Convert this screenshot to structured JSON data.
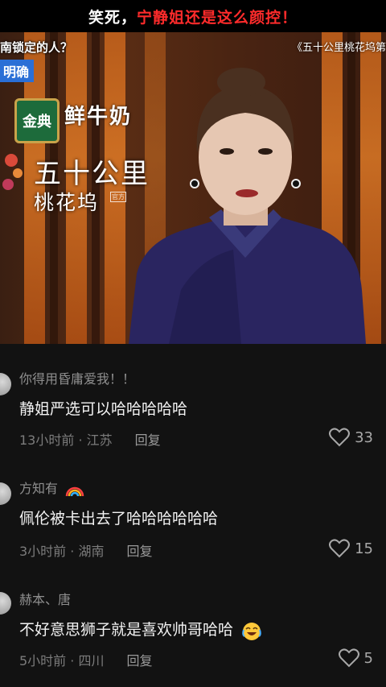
{
  "caption": {
    "part1": "笑死，",
    "part2": "宁静姐还是这么颜控！",
    "color_white": "#ffffff",
    "color_red": "#ff2b2b"
  },
  "video": {
    "subtitle_top": "南锁定的人？",
    "subtitle_tag": "明确",
    "show_title": "《五十公里桃花坞第",
    "sponsor_logo": "金典",
    "sponsor_text": "鲜牛奶",
    "logo_big": "五十公里",
    "logo_small": "桃花坞",
    "logo_badge": "官方"
  },
  "comments": [
    {
      "username": "你得用昏庸爱我！！",
      "text": "静姐严选可以哈哈哈哈哈",
      "time_location": "13小时前 · 江苏",
      "reply": "回复",
      "likes": "33"
    },
    {
      "username": "方知有",
      "username_icon": "rainbow-icon",
      "text": "佩伦被卡出去了哈哈哈哈哈哈",
      "time_location": "3小时前 · 湖南",
      "reply": "回复",
      "likes": "15"
    },
    {
      "username": "赫本、唐",
      "text": "不好意思狮子就是喜欢帅哥哈哈",
      "text_icon": "crying-laughing-icon",
      "time_location": "5小时前 · 四川",
      "reply": "回复",
      "likes": "5"
    }
  ]
}
